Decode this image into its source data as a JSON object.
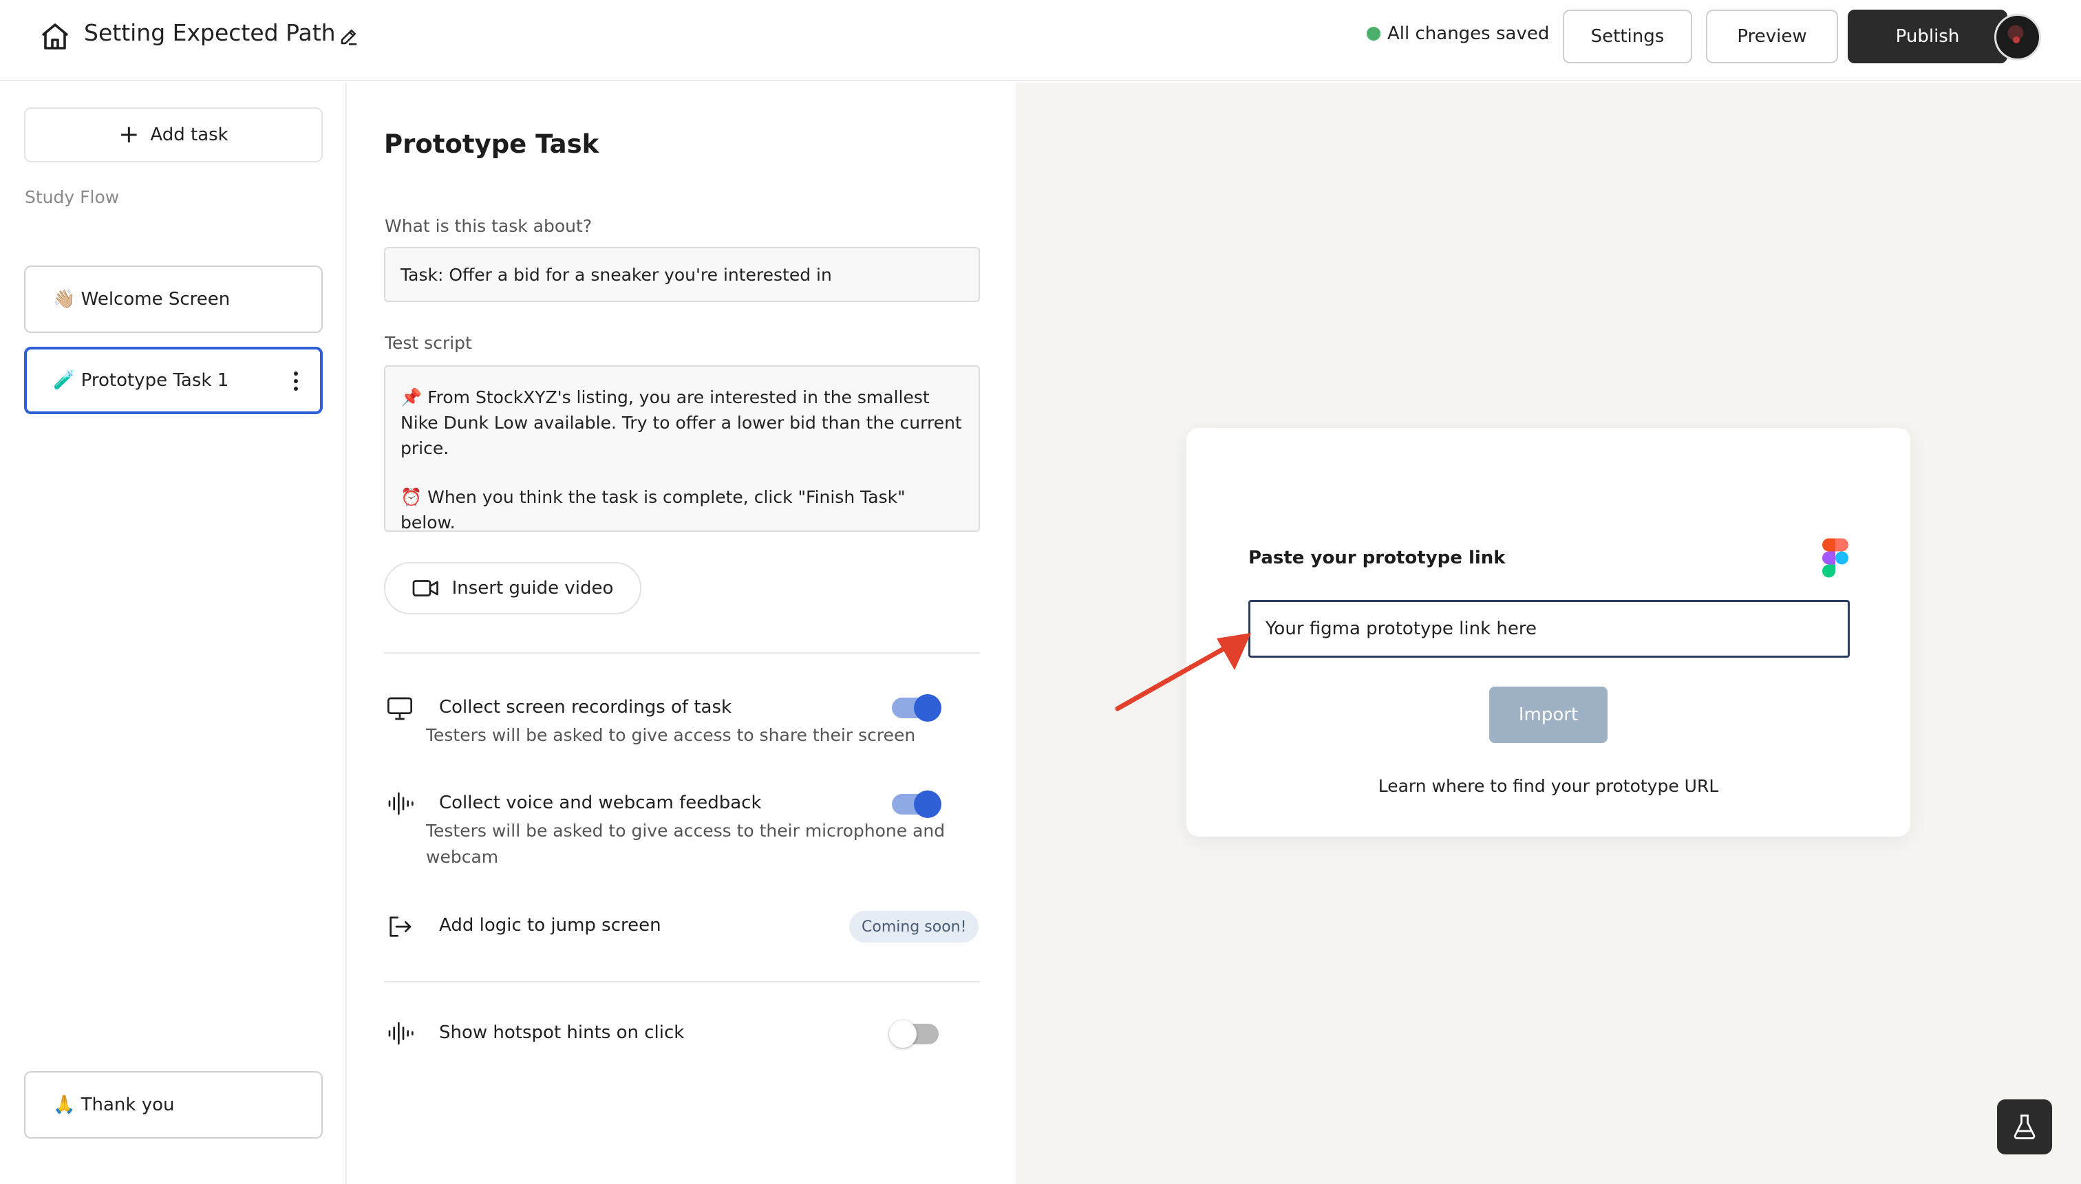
{
  "header": {
    "title": "Setting Expected Path",
    "save_status": "All changes saved",
    "settings_label": "Settings",
    "preview_label": "Preview",
    "publish_label": "Publish"
  },
  "sidebar": {
    "add_task_label": "Add task",
    "flow_label": "Study Flow",
    "items": [
      {
        "emoji": "👋🏼",
        "label": "Welcome Screen"
      },
      {
        "emoji": "🧪",
        "label": "Prototype Task 1"
      },
      {
        "emoji": "🙏",
        "label": "Thank you"
      }
    ]
  },
  "task": {
    "panel_title": "Prototype Task",
    "about_label": "What is this task about?",
    "about_value": "Task: Offer a bid for a sneaker you're interested in",
    "script_label": "Test script",
    "script_para1": "From StockXYZ's listing, you are interested in the smallest Nike Dunk Low available. Try to offer a lower bid than the current price.",
    "script_para2": "When you think the task is complete, click \"Finish Task\" below.",
    "guide_video_label": "Insert guide video",
    "options": {
      "screen": {
        "title": "Collect screen recordings of task",
        "desc": "Testers will be asked to give access to share their screen",
        "enabled": true
      },
      "voice": {
        "title": "Collect voice and webcam feedback",
        "desc": "Testers will be asked to give access to their microphone and webcam",
        "enabled": true
      },
      "logic": {
        "title": "Add logic to jump screen",
        "badge": "Coming soon!"
      },
      "hotspot": {
        "title": "Show hotspot hints on click",
        "enabled": false
      }
    }
  },
  "import": {
    "label": "Paste your prototype link",
    "input_value": "Your figma prototype link here",
    "import_label": "Import",
    "learn_link": "Learn where to find your prototype URL"
  },
  "colors": {
    "accent": "#2f5fd6",
    "publish_bg": "#2b2b2b",
    "saved_dot": "#4caf6a",
    "annotation_arrow": "#e2402b",
    "import_disabled": "#9fb1c4",
    "canvas_bg": "#f5f4f1"
  },
  "icons": [
    "home-icon",
    "pencil-icon",
    "plus-icon",
    "kebab-icon",
    "video-camera-icon",
    "monitor-icon",
    "waveform-icon",
    "exit-arrow-icon",
    "figma-icon",
    "flask-icon",
    "annotation-arrow"
  ]
}
